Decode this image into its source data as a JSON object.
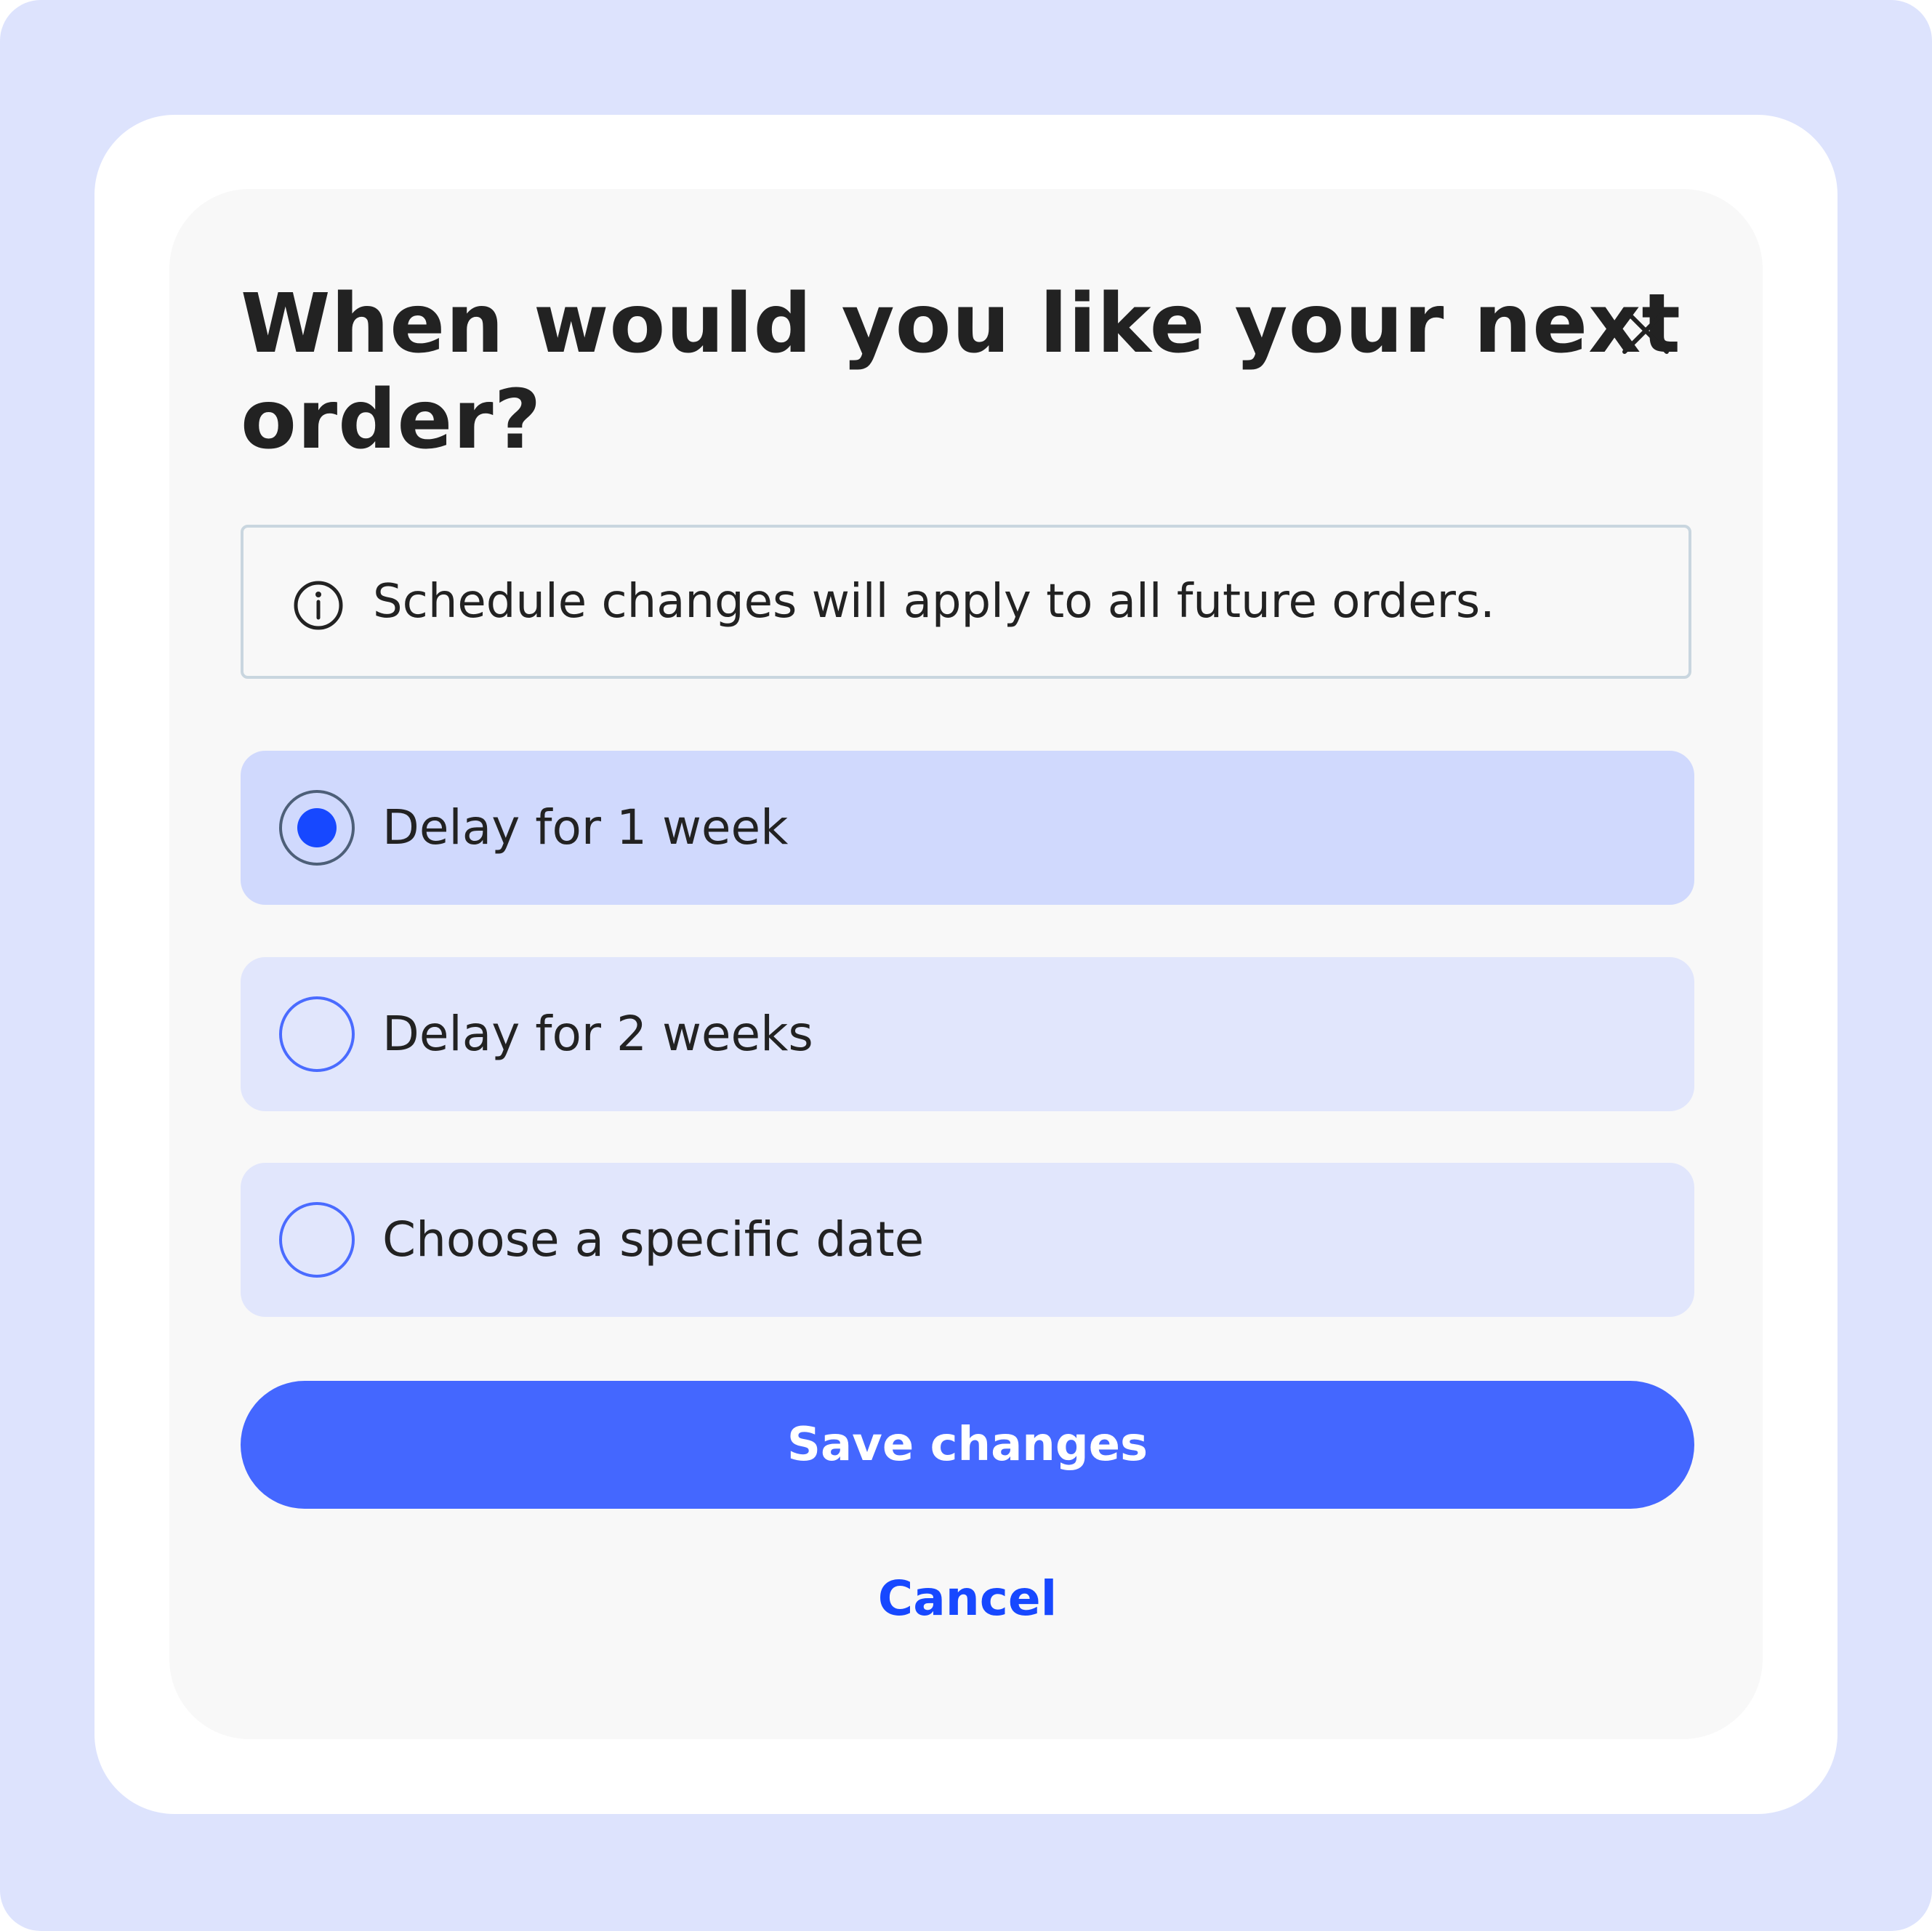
{
  "dialog": {
    "title": "When would you like your next order?",
    "close_icon": "close-icon",
    "info": {
      "icon": "info-icon",
      "text": "Schedule changes will apply to all future orders."
    },
    "options": [
      {
        "label": "Delay for 1 week",
        "selected": true
      },
      {
        "label": "Delay for 2 weeks",
        "selected": false
      },
      {
        "label": "Choose a specific date",
        "selected": false
      }
    ],
    "save_label": "Save changes",
    "cancel_label": "Cancel"
  },
  "colors": {
    "backdrop": "#dde3fd",
    "accent": "#4467ff",
    "link": "#1748ff",
    "selected_option_bg": "#d0d9fd",
    "option_bg": "#e1e6fc"
  }
}
